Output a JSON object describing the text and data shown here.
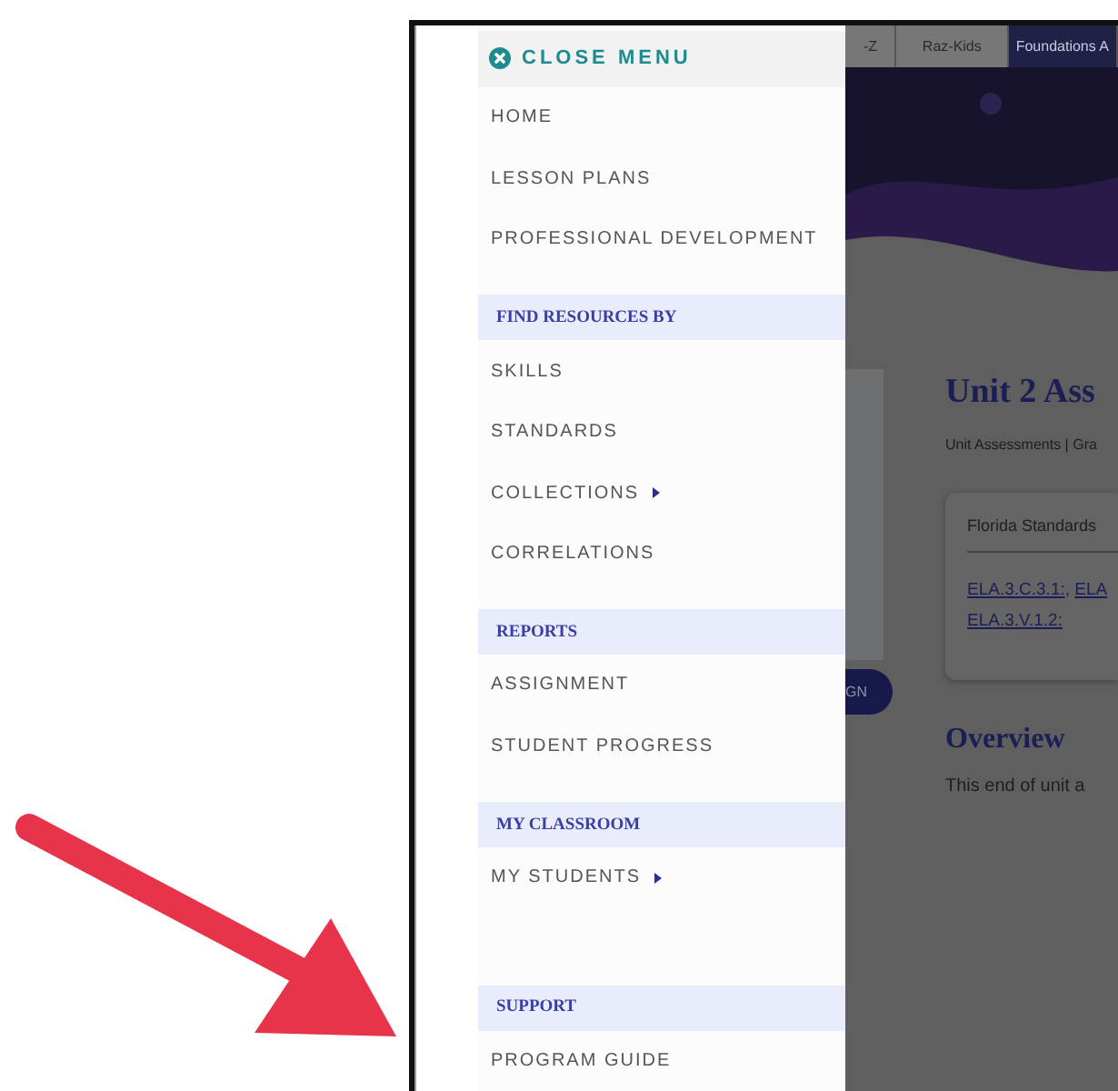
{
  "menu": {
    "close_label": "CLOSE MENU",
    "sections": [
      {
        "items": [
          {
            "label": "HOME",
            "submenu": false
          },
          {
            "label": "LESSON PLANS",
            "submenu": false
          },
          {
            "label": "PROFESSIONAL DEVELOPMENT",
            "submenu": false
          }
        ]
      },
      {
        "heading": "FIND RESOURCES BY",
        "items": [
          {
            "label": "SKILLS",
            "submenu": false
          },
          {
            "label": "STANDARDS",
            "submenu": false
          },
          {
            "label": "COLLECTIONS",
            "submenu": true
          },
          {
            "label": "CORRELATIONS",
            "submenu": false
          }
        ]
      },
      {
        "heading": "REPORTS",
        "items": [
          {
            "label": "ASSIGNMENT",
            "submenu": false
          },
          {
            "label": "STUDENT PROGRESS",
            "submenu": false
          }
        ]
      },
      {
        "heading": "MY CLASSROOM",
        "items": [
          {
            "label": "MY STUDENTS",
            "submenu": true
          }
        ]
      },
      {
        "heading": "SUPPORT",
        "items": [
          {
            "label": "PROGRAM GUIDE",
            "submenu": false
          }
        ]
      }
    ]
  },
  "page": {
    "tabs": [
      {
        "label": "-Z",
        "selected": false
      },
      {
        "label": "Raz-Kids",
        "selected": false
      },
      {
        "label": "Foundations A",
        "selected": true
      }
    ],
    "button_label": "GN",
    "title": "Unit 2 Ass",
    "breadcrumb": "Unit Assessments | Gra",
    "card": {
      "heading": "Florida Standards",
      "links": [
        {
          "text": "ELA.3.C.3.1:",
          "after": ","
        },
        {
          "text": "ELA"
        },
        {
          "text": "ELA.3.V.1.2:"
        }
      ]
    },
    "overview_heading": "Overview",
    "overview_text": "This end of unit a"
  }
}
